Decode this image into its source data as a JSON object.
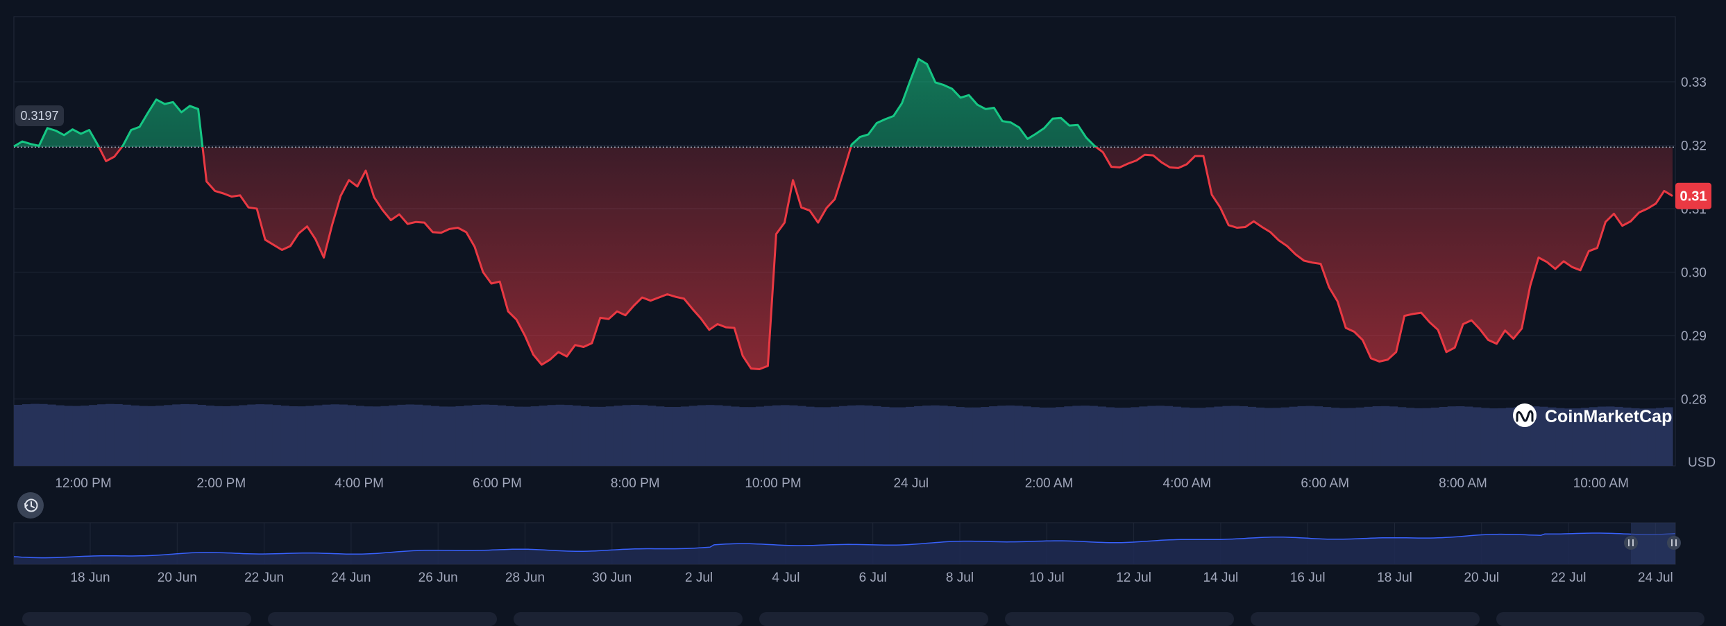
{
  "chart_data": {
    "type": "area",
    "ylim": [
      0.28,
      0.34
    ],
    "baseline": 0.3197,
    "baseline_label": "0.3197",
    "current_price": 0.31,
    "current_label": "0.31",
    "y_ticks": [
      "0.28",
      "0.29",
      "0.30",
      "0.31",
      "0.32",
      "0.33"
    ],
    "x_ticks": [
      "12:00 PM",
      "2:00 PM",
      "4:00 PM",
      "6:00 PM",
      "8:00 PM",
      "10:00 PM",
      "24 Jul",
      "2:00 AM",
      "4:00 AM",
      "6:00 AM",
      "8:00 AM",
      "10:00 AM"
    ],
    "currency": "USD",
    "colors": {
      "up": "#16c784",
      "down": "#ea3943",
      "volume": "#2a3763",
      "overview_line": "#3861fb"
    },
    "series": [
      {
        "values": [
          0.3198,
          0.3206,
          0.3202,
          0.3199,
          0.3227,
          0.3223,
          0.3216,
          0.3225,
          0.3218,
          0.3224,
          0.3201,
          0.3175,
          0.3182,
          0.3199,
          0.3224,
          0.3229,
          0.3251,
          0.3272,
          0.3265,
          0.3268,
          0.3252,
          0.3262,
          0.3257,
          0.3143,
          0.3128,
          0.3124,
          0.3119,
          0.3121,
          0.3102,
          0.31,
          0.3051,
          0.3043,
          0.3035,
          0.3041,
          0.3061,
          0.3072,
          0.3052,
          0.3023,
          0.3075,
          0.312,
          0.3145,
          0.3135,
          0.316,
          0.3118,
          0.3098,
          0.3082,
          0.3091,
          0.3076,
          0.3079,
          0.3078,
          0.3063,
          0.3062,
          0.3068,
          0.307,
          0.3063,
          0.304,
          0.3,
          0.2982,
          0.2985,
          0.2938,
          0.2925,
          0.29,
          0.287,
          0.2854,
          0.2862,
          0.2874,
          0.2867,
          0.2885,
          0.2882,
          0.2888,
          0.2928,
          0.2926,
          0.2938,
          0.2932,
          0.2947,
          0.296,
          0.2955,
          0.296,
          0.2965,
          0.2961,
          0.2958,
          0.2942,
          0.2927,
          0.2909,
          0.2918,
          0.2913,
          0.2912,
          0.2868,
          0.2848,
          0.2847,
          0.2852,
          0.306,
          0.3078,
          0.3145,
          0.3102,
          0.3097,
          0.3078,
          0.3101,
          0.3115,
          0.3157,
          0.3201,
          0.3213,
          0.3217,
          0.3235,
          0.3241,
          0.3246,
          0.3266,
          0.3302,
          0.3336,
          0.3328,
          0.3299,
          0.3295,
          0.3289,
          0.3275,
          0.3279,
          0.3264,
          0.3257,
          0.3259,
          0.3238,
          0.3236,
          0.3228,
          0.321,
          0.3218,
          0.3227,
          0.3242,
          0.3243,
          0.3231,
          0.3232,
          0.3212,
          0.3199,
          0.3189,
          0.3166,
          0.3165,
          0.3171,
          0.3176,
          0.3185,
          0.3184,
          0.3173,
          0.3165,
          0.3164,
          0.317,
          0.3183,
          0.3183,
          0.3122,
          0.3102,
          0.3074,
          0.307,
          0.3071,
          0.308,
          0.3071,
          0.3063,
          0.305,
          0.3041,
          0.3028,
          0.3018,
          0.3015,
          0.3013,
          0.2976,
          0.2954,
          0.2912,
          0.2906,
          0.2893,
          0.2864,
          0.2859,
          0.2862,
          0.2874,
          0.2931,
          0.2934,
          0.2936,
          0.2921,
          0.2909,
          0.2874,
          0.2881,
          0.2918,
          0.2924,
          0.291,
          0.2893,
          0.2887,
          0.2908,
          0.2895,
          0.2911,
          0.2978,
          0.3023,
          0.3016,
          0.3005,
          0.3017,
          0.3008,
          0.3003,
          0.3033,
          0.3038,
          0.3079,
          0.3092,
          0.3073,
          0.308,
          0.3094,
          0.31,
          0.3108,
          0.3128,
          0.312
        ]
      }
    ],
    "overview": {
      "x_ticks": [
        "18 Jun",
        "20 Jun",
        "22 Jun",
        "24 Jun",
        "26 Jun",
        "28 Jun",
        "30 Jun",
        "2 Jul",
        "4 Jul",
        "6 Jul",
        "8 Jul",
        "10 Jul",
        "12 Jul",
        "14 Jul",
        "16 Jul",
        "18 Jul",
        "20 Jul",
        "22 Jul",
        "24 Jul"
      ]
    }
  },
  "brand": {
    "name": "CoinMarketCap"
  },
  "icons": {
    "history": "history-icon",
    "handle": "drag-handle-icon",
    "logo": "coinmarketcap-logo-icon"
  }
}
